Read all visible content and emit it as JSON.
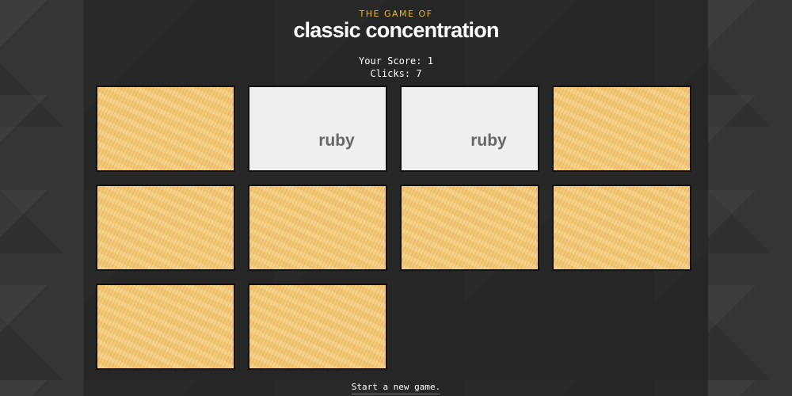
{
  "header": {
    "subtitle": "THE GAME OF",
    "title": "classic concentration"
  },
  "stats": {
    "score_label": "Your Score: 1",
    "clicks_label": "Clicks: 7"
  },
  "cards": [
    {
      "state": "face-down",
      "label": ""
    },
    {
      "state": "face-up",
      "label": "ruby"
    },
    {
      "state": "face-up",
      "label": "ruby"
    },
    {
      "state": "face-down",
      "label": ""
    },
    {
      "state": "face-down",
      "label": ""
    },
    {
      "state": "face-down",
      "label": ""
    },
    {
      "state": "face-down",
      "label": ""
    },
    {
      "state": "face-down",
      "label": ""
    },
    {
      "state": "face-down",
      "label": ""
    },
    {
      "state": "face-down",
      "label": ""
    }
  ],
  "footer": {
    "new_game_label": "Start a new game."
  },
  "colors": {
    "accent": "#e9b825",
    "card_back": "#f2c877",
    "card_face": "#efefef",
    "background": "#262626"
  }
}
